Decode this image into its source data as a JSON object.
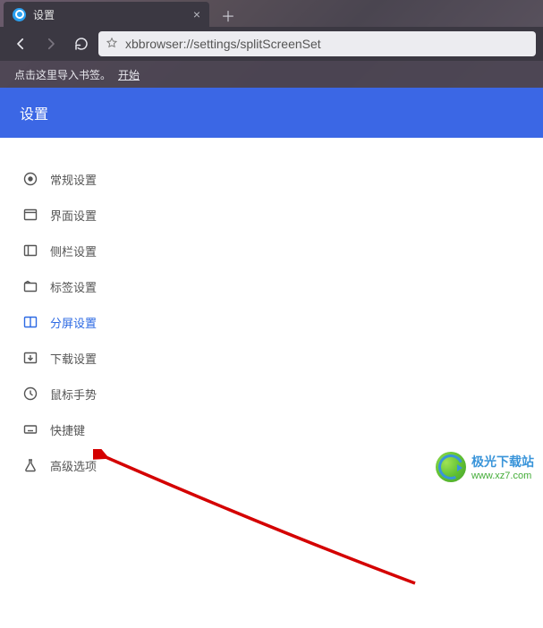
{
  "tab": {
    "title": "设置"
  },
  "url": "xbbrowser://settings/splitScreenSet",
  "bookmarks": {
    "hint": "点击这里导入书签。",
    "link": "开始"
  },
  "settings_header": "设置",
  "sidebar": {
    "items": [
      {
        "label": "常规设置"
      },
      {
        "label": "界面设置"
      },
      {
        "label": "侧栏设置"
      },
      {
        "label": "标签设置"
      },
      {
        "label": "分屏设置"
      },
      {
        "label": "下载设置"
      },
      {
        "label": "鼠标手势"
      },
      {
        "label": "快捷键"
      },
      {
        "label": "高级选项"
      }
    ],
    "active_index": 4
  },
  "watermark": {
    "brand": "极光下载站",
    "url": "www.xz7.com"
  }
}
